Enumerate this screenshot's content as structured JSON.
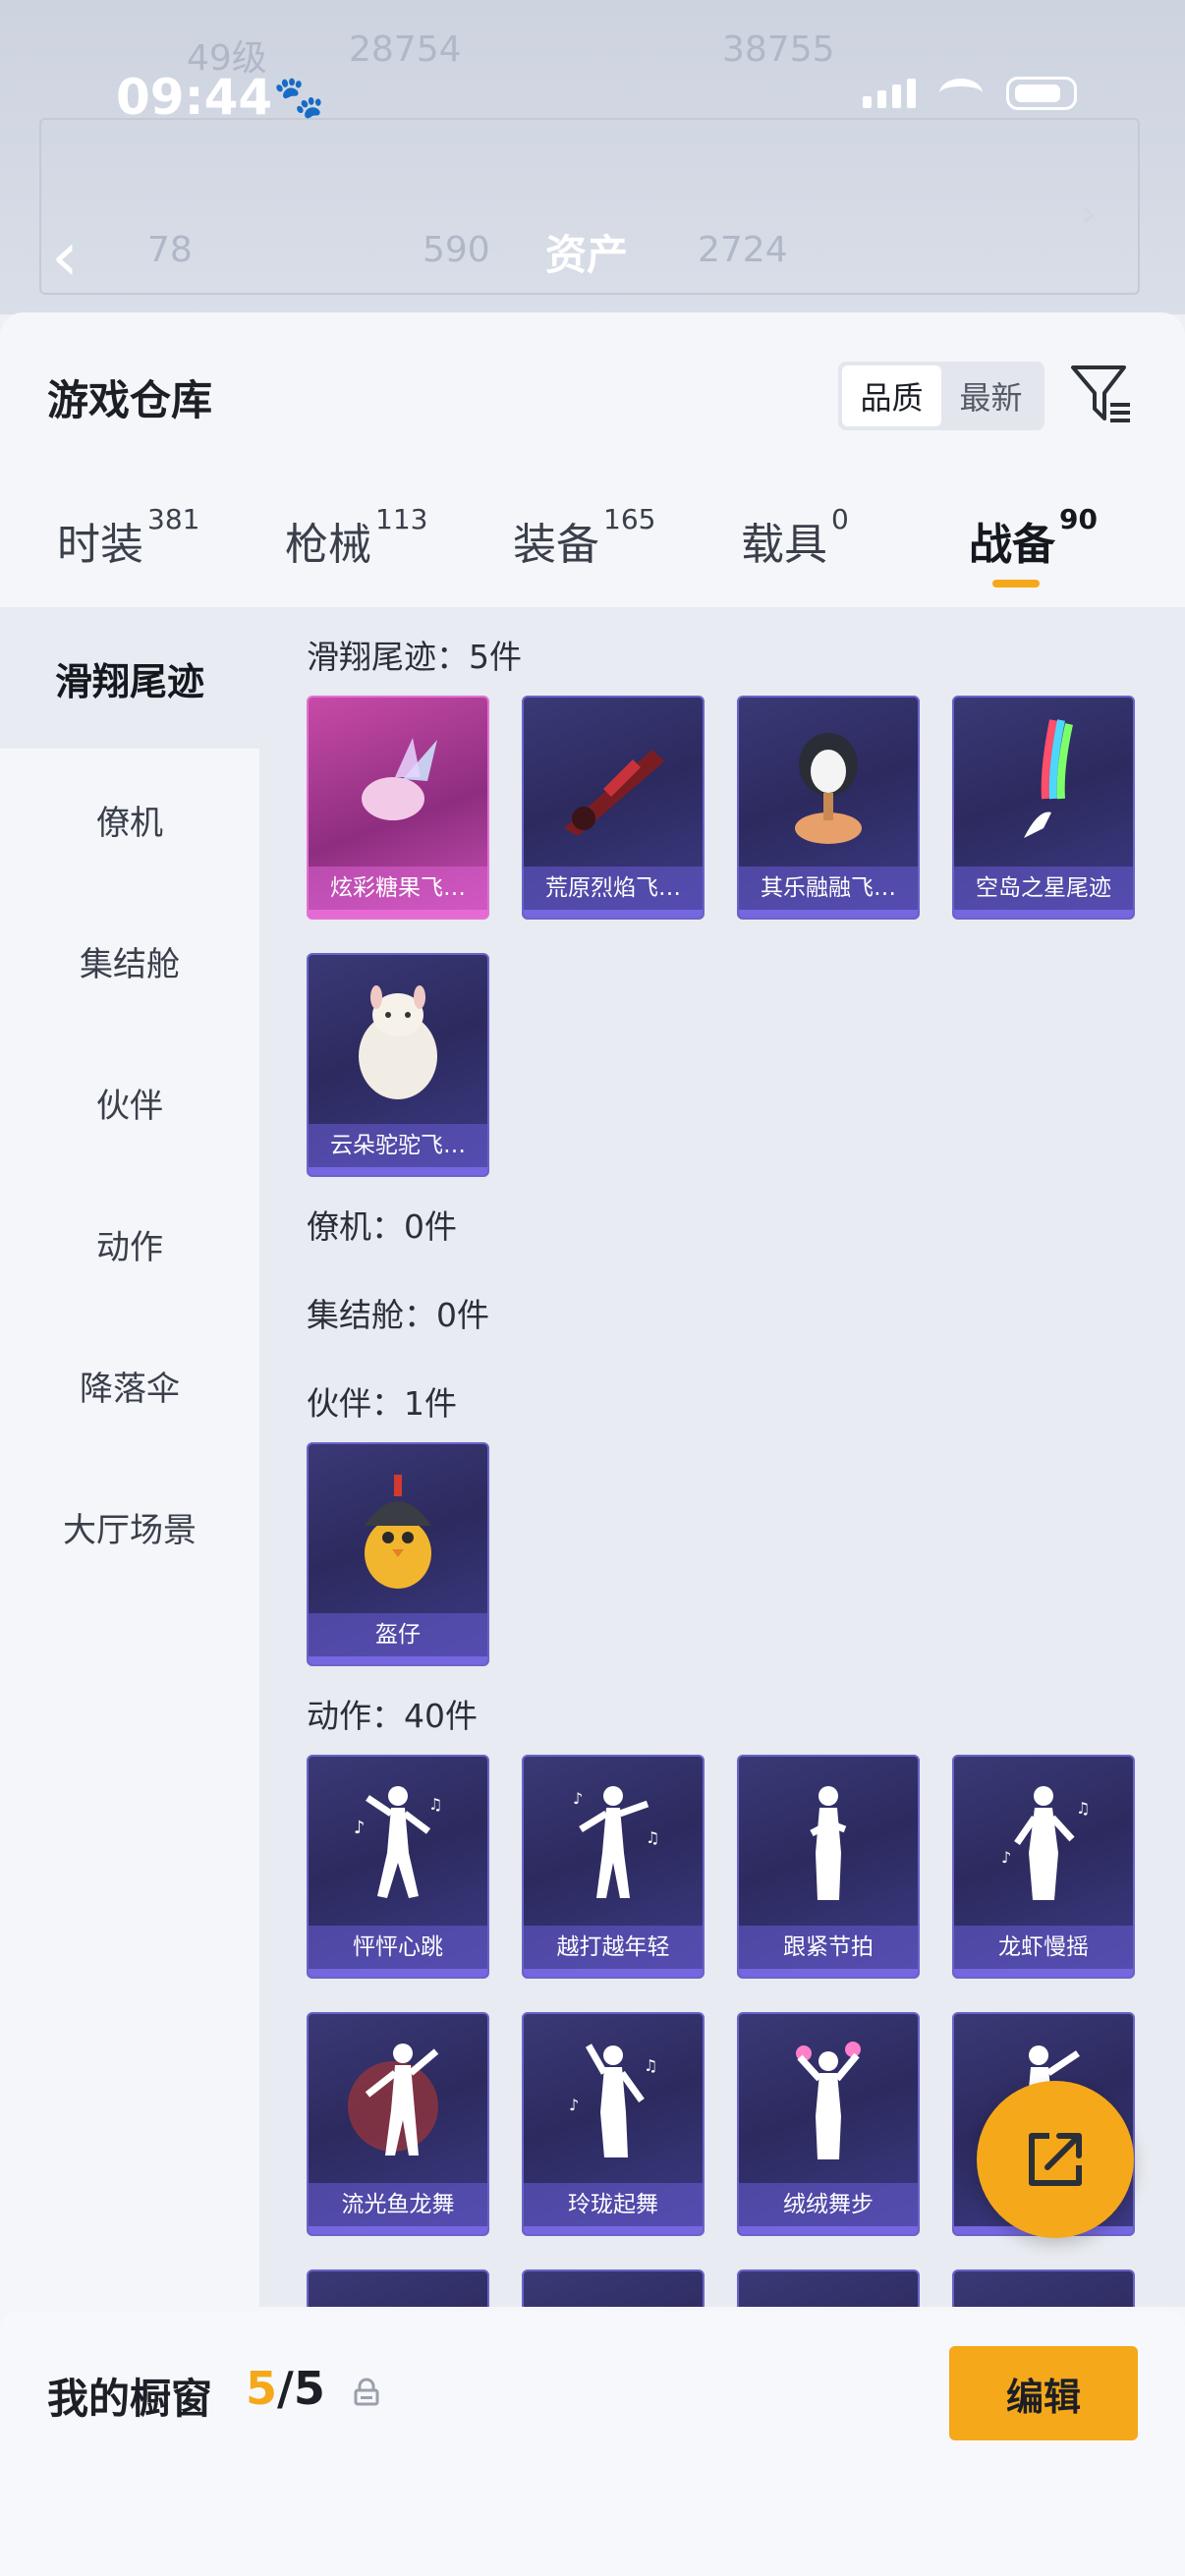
{
  "status_bar": {
    "time": "09:44"
  },
  "backdrop": {
    "level_text": "49级",
    "stat_1": "28754",
    "stat_2": "38755",
    "asset_title": "资产",
    "asset_value_1": "78",
    "asset_value_2": "590",
    "asset_value_3": "2724"
  },
  "sheet": {
    "title": "游戏仓库",
    "sort_options": [
      "品质",
      "最新"
    ],
    "active_sort": "品质"
  },
  "tabs": [
    {
      "label": "时装",
      "count": "381"
    },
    {
      "label": "枪械",
      "count": "113"
    },
    {
      "label": "装备",
      "count": "165"
    },
    {
      "label": "载具",
      "count": "0"
    },
    {
      "label": "战备",
      "count": "90"
    }
  ],
  "categories": [
    "滑翔尾迹",
    "僚机",
    "集结舱",
    "伙伴",
    "动作",
    "降落伞",
    "大厅场景"
  ],
  "sections": {
    "glide_trail": {
      "label": "滑翔尾迹：5件",
      "items": [
        "炫彩糖果飞…",
        "荒原烈焰飞…",
        "其乐融融飞…",
        "空岛之星尾迹",
        "云朵驼驼飞…"
      ]
    },
    "wingman": {
      "label": "僚机：0件"
    },
    "pod": {
      "label": "集结舱：0件"
    },
    "partner": {
      "label": "伙伴：1件",
      "items": [
        "盔仔"
      ]
    },
    "emote": {
      "label": "动作：40件",
      "items": [
        "怦怦心跳",
        "越打越年轻",
        "跟紧节拍",
        "龙虾慢摇",
        "流光鱼龙舞",
        "玲珑起舞",
        "绒绒舞步"
      ]
    }
  },
  "bottom_bar": {
    "title": "我的橱窗",
    "count_current": "5",
    "count_total": "/5",
    "edit_label": "编辑"
  },
  "colors": {
    "accent": "#f5a81a",
    "card_purple": "#2c2a5e",
    "card_pink": "#8e2e80"
  }
}
